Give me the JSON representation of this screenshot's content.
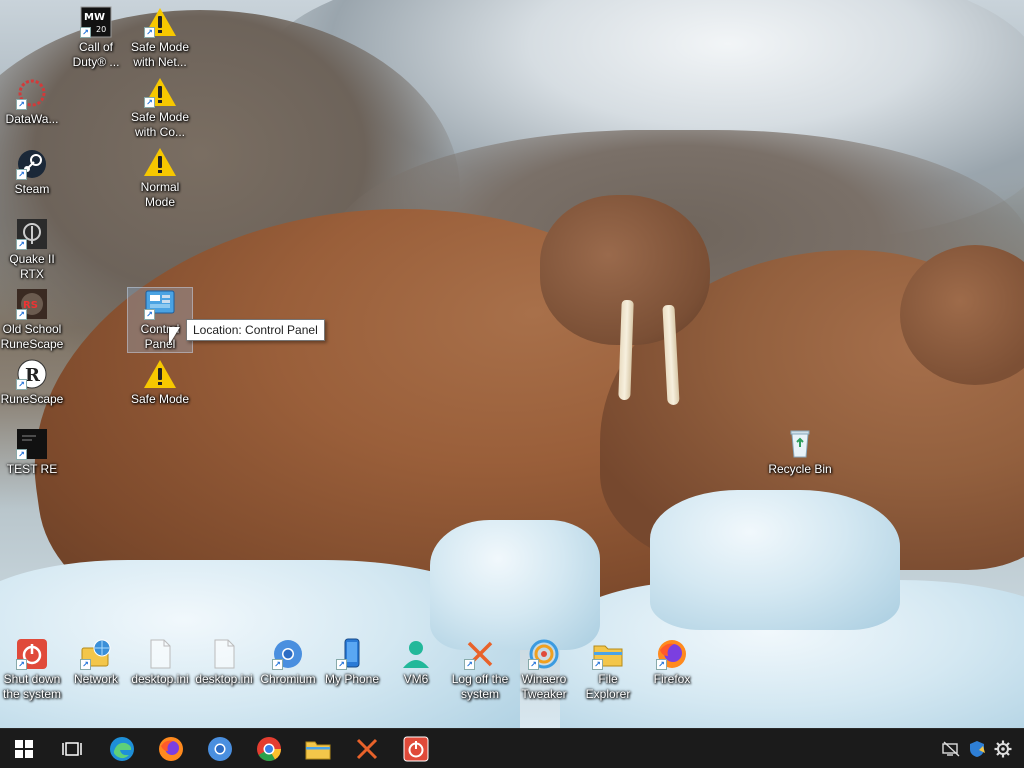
{
  "desktop": {
    "icons": [
      {
        "label": "Call of Duty® ...",
        "icon": "call-of-duty-icon",
        "shortcut": true
      },
      {
        "label": "Safe Mode with Net...",
        "icon": "warning-icon",
        "shortcut": true
      },
      {
        "label": "DataWa...",
        "icon": "datawave-icon",
        "shortcut": true
      },
      {
        "label": "Safe Mode with Co...",
        "icon": "warning-icon",
        "shortcut": true
      },
      {
        "label": "Steam",
        "icon": "steam-icon",
        "shortcut": true
      },
      {
        "label": "Normal Mode",
        "icon": "warning-icon",
        "shortcut": false
      },
      {
        "label": "Quake II RTX",
        "icon": "quake-icon",
        "shortcut": true
      },
      {
        "label": "Old School RuneScape",
        "icon": "old-school-runescape-icon",
        "shortcut": true
      },
      {
        "label": "Control Panel",
        "icon": "control-panel-icon",
        "shortcut": true,
        "selected": true
      },
      {
        "label": "RuneScape",
        "icon": "runescape-icon",
        "shortcut": true
      },
      {
        "label": "Safe Mode",
        "icon": "warning-icon",
        "shortcut": false
      },
      {
        "label": "TEST RE",
        "icon": "test-re-icon",
        "shortcut": true
      },
      {
        "label": "Recycle Bin",
        "icon": "recycle-bin-icon",
        "shortcut": false
      },
      {
        "label": "Shut down the system",
        "icon": "shutdown-icon",
        "shortcut": true
      },
      {
        "label": "Network",
        "icon": "network-icon",
        "shortcut": true
      },
      {
        "label": "desktop.ini",
        "icon": "ini-file-icon",
        "shortcut": false
      },
      {
        "label": "desktop.ini",
        "icon": "ini-file-icon",
        "shortcut": false
      },
      {
        "label": "Chromium",
        "icon": "chromium-icon",
        "shortcut": true
      },
      {
        "label": "My Phone",
        "icon": "phone-icon",
        "shortcut": true
      },
      {
        "label": "VM6",
        "icon": "user-icon",
        "shortcut": false
      },
      {
        "label": "Log off the system",
        "icon": "log-off-icon",
        "shortcut": true
      },
      {
        "label": "Winaero Tweaker",
        "icon": "winaero-tweaker-icon",
        "shortcut": true
      },
      {
        "label": "File Explorer",
        "icon": "file-explorer-icon",
        "shortcut": true
      },
      {
        "label": "Firefox",
        "icon": "firefox-icon",
        "shortcut": true
      }
    ]
  },
  "tooltip": {
    "text": "Location: Control Panel"
  },
  "taskbar": {
    "items": [
      {
        "name": "start-button",
        "icon": "windows-logo-icon"
      },
      {
        "name": "task-view-button",
        "icon": "task-view-icon"
      },
      {
        "name": "edge-button",
        "icon": "edge-icon"
      },
      {
        "name": "firefox-button",
        "icon": "firefox-icon"
      },
      {
        "name": "chromium-button",
        "icon": "chromium-icon"
      },
      {
        "name": "chrome-button",
        "icon": "chrome-icon"
      },
      {
        "name": "file-explorer-button",
        "icon": "folder-icon"
      },
      {
        "name": "log-off-button",
        "icon": "log-off-icon"
      },
      {
        "name": "shutdown-button",
        "icon": "shutdown-icon"
      }
    ],
    "tray": [
      {
        "name": "network-tray",
        "icon": "network-disconnected-icon"
      },
      {
        "name": "security-tray",
        "icon": "windows-security-icon"
      },
      {
        "name": "settings-tray",
        "icon": "gear-icon"
      }
    ]
  },
  "colors": {
    "taskbar": "#1b1b1b",
    "warning": "#f7c800",
    "accent": "#1c6fd8"
  }
}
